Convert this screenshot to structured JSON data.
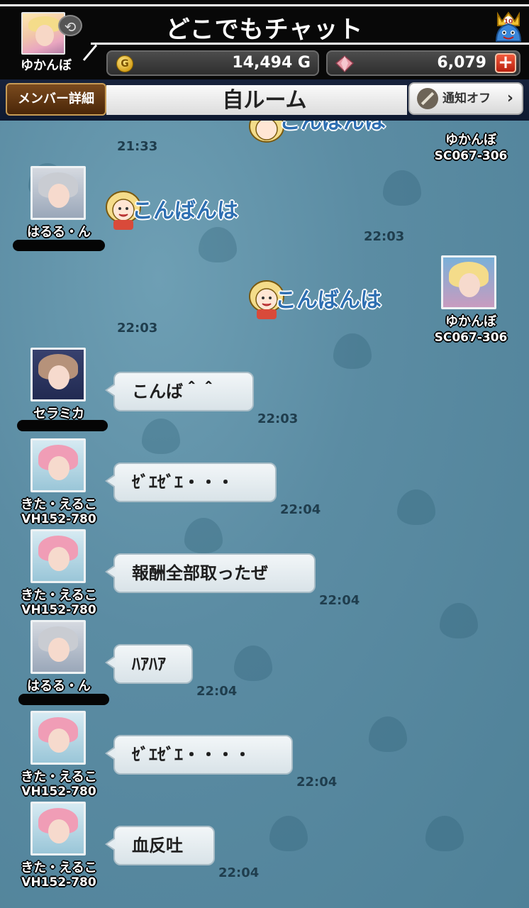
{
  "header": {
    "title": "どこでもチャット",
    "my_name": "ゆかんぼ",
    "gold": "14,494 G",
    "gold_icon_letter": "G",
    "gems": "6,079",
    "plus": "+",
    "crown_badge": "10"
  },
  "room": {
    "member_button": "メンバー詳細",
    "title": "自ルーム",
    "notify_label": "通知オフ",
    "notify_chevron": "›"
  },
  "messages": {
    "partial_top": {
      "stamp_text": "こんばんは",
      "name": "ゆかんぼ",
      "uid": "SC067-306",
      "time": "21:33"
    },
    "m1": {
      "name": "はるる・ん",
      "stamp_text": "こんばんは",
      "time": "22:03"
    },
    "m2": {
      "name": "ゆかんぼ",
      "uid": "SC067-306",
      "stamp_text": "こんばんは",
      "time": "22:03"
    },
    "m3": {
      "name": "セラミカ",
      "text": "こんば＾＾",
      "time": "22:03"
    },
    "m4": {
      "name": "きた・えるこ",
      "uid": "VH152-780",
      "text": "ｾﾞｴｾﾞｴ・・・",
      "time": "22:04"
    },
    "m5": {
      "name": "きた・えるこ",
      "uid": "VH152-780",
      "text": "報酬全部取ったぜ",
      "time": "22:04"
    },
    "m6": {
      "name": "はるる・ん",
      "text": "ﾊｱﾊｱ",
      "time": "22:04"
    },
    "m7": {
      "name": "きた・えるこ",
      "uid": "VH152-780",
      "text": "ｾﾞｴｾﾞｴ・・・・",
      "time": "22:04"
    },
    "m8": {
      "name": "きた・えるこ",
      "uid": "VH152-780",
      "text": "血反吐",
      "time": "22:04"
    }
  },
  "colors": {
    "chat_background": "#5b8ca3",
    "bubble": "#eef3f6",
    "stamp_text": "#2e6fb2",
    "plus_button": "#d8361e"
  }
}
